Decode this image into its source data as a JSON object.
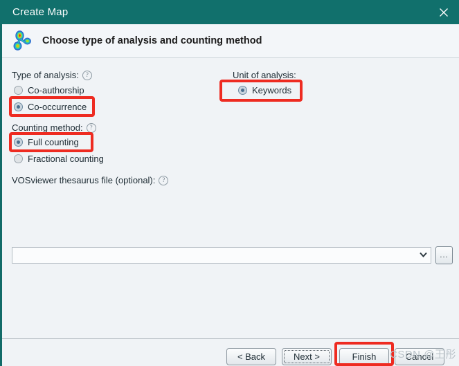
{
  "window": {
    "title": "Create Map",
    "close_icon": "close-icon"
  },
  "header": {
    "title": "Choose type of analysis and counting method",
    "logo_icon": "vosviewer-cluster-logo-icon"
  },
  "sections": {
    "type_of_analysis": {
      "label": "Type of analysis:",
      "help_icon": "?",
      "options": [
        {
          "label": "Co-authorship",
          "selected": false
        },
        {
          "label": "Co-occurrence",
          "selected": true
        }
      ]
    },
    "unit_of_analysis": {
      "label": "Unit of analysis:",
      "options": [
        {
          "label": "Keywords",
          "selected": true
        }
      ]
    },
    "counting_method": {
      "label": "Counting method:",
      "help_icon": "?",
      "options": [
        {
          "label": "Full counting",
          "selected": true
        },
        {
          "label": "Fractional counting",
          "selected": false
        }
      ]
    },
    "thesaurus": {
      "label": "VOSviewer thesaurus file (optional):",
      "help_icon": "?",
      "value": "",
      "placeholder": "",
      "dropdown_icon": "chevron-down-icon",
      "browse_label": "..."
    }
  },
  "footer": {
    "back_label": "< Back",
    "next_label": "Next >",
    "finish_label": "Finish",
    "cancel_label": "Cancel"
  },
  "watermark": {
    "text": "CSDN @王彤"
  },
  "colors": {
    "titlebar": "#11706c",
    "annotation_red": "#ee2b21",
    "background": "#f0f3f6",
    "radio_dot": "#4a6f8e"
  }
}
